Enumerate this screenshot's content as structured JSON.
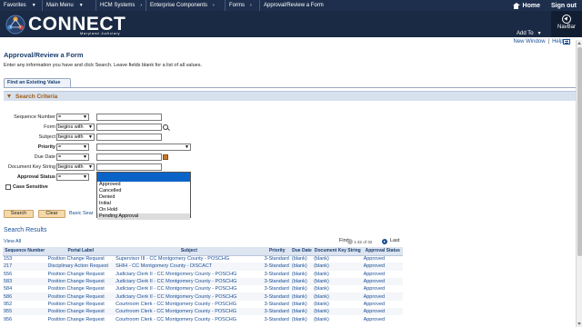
{
  "topnav": {
    "items": [
      {
        "label": "Favorites"
      },
      {
        "label": "Main Menu"
      },
      {
        "label": "HCM Systems"
      },
      {
        "label": "Enterprise Components"
      },
      {
        "label": "Forms"
      },
      {
        "label": "Approval/Review a Form"
      }
    ],
    "home": "Home",
    "signout": "Sign out"
  },
  "banner": {
    "logo_text": "CONNECT",
    "logo_subtitle": "Maryland Judiciary",
    "add_to": "Add To",
    "navbar": "NavBar"
  },
  "utility": {
    "new_window": "New Window",
    "help": "Help"
  },
  "page": {
    "title": "Approval/Review a Form",
    "instructions": "Enter any information you have and click Search. Leave fields blank for a list of all values.",
    "tab_label": "Find an Existing Value",
    "section_title": "Search Criteria"
  },
  "criteria": {
    "sequence_number": {
      "label": "Sequence Number",
      "operator": "="
    },
    "form": {
      "label": "Form",
      "operator": "begins with"
    },
    "subject": {
      "label": "Subject",
      "operator": "begins with"
    },
    "priority": {
      "label": "Priority",
      "operator": "="
    },
    "due_date": {
      "label": "Due Date",
      "operator": "="
    },
    "document_key_string": {
      "label": "Document Key String",
      "operator": "begins with"
    },
    "approval_status": {
      "label": "Approval Status",
      "operator": "=",
      "options": [
        "Approved",
        "Cancelled",
        "Denied",
        "Initial",
        "On Hold",
        "Pending Approval"
      ]
    },
    "case_sensitive": "Case Sensitive"
  },
  "buttons": {
    "search": "Search",
    "clear": "Clear",
    "basic_search": "Basic Sear"
  },
  "results": {
    "title": "Search Results",
    "view_all": "View All",
    "pager": {
      "first": "First",
      "count": "1-32 of 32",
      "last": "Last"
    },
    "columns": [
      "Sequence Number",
      "Portal Label",
      "Subject",
      "Priority",
      "Due Date",
      "Document Key String",
      "Approval Status"
    ],
    "rows": [
      [
        "153",
        "Position Change Request",
        "Supervisor III - CC Montgomery County - POSCHG",
        "3-Standard",
        "(blank)",
        "(blank)",
        "Approved"
      ],
      [
        "217",
        "Disciplinary Action Request",
        "SHIH - CC Montgomery County - DISCACT",
        "3-Standard",
        "(blank)",
        "(blank)",
        "Approved"
      ],
      [
        "556",
        "Position Change Request",
        "Judiciary Clerk II - CC Montgomery County - POSCHG",
        "3-Standard",
        "(blank)",
        "(blank)",
        "Approved"
      ],
      [
        "583",
        "Position Change Request",
        "Judiciary Clerk II - CC Montgomery County - POSCHG",
        "3-Standard",
        "(blank)",
        "(blank)",
        "Approved"
      ],
      [
        "584",
        "Position Change Request",
        "Judiciary Clerk II - CC Montgomery County - POSCHG",
        "3-Standard",
        "(blank)",
        "(blank)",
        "Approved"
      ],
      [
        "586",
        "Position Change Request",
        "Judiciary Clerk II - CC Montgomery County - POSCHG",
        "3-Standard",
        "(blank)",
        "(blank)",
        "Approved"
      ],
      [
        "952",
        "Position Change Request",
        "Courtroom Clerk - CC Montgomery County - POSCHG",
        "3-Standard",
        "(blank)",
        "(blank)",
        "Approved"
      ],
      [
        "955",
        "Position Change Request",
        "Courtroom Clerk - CC Montgomery County - POSCHG",
        "3-Standard",
        "(blank)",
        "(blank)",
        "Approved"
      ],
      [
        "956",
        "Position Change Request",
        "Courtroom Clerk - CC Montgomery County - POSCHG",
        "3-Standard",
        "(blank)",
        "(blank)",
        "Approved"
      ]
    ]
  },
  "colors": {
    "nav": "#1e2f4d",
    "banner": "#1a2a44",
    "link": "#1a4f95",
    "section_text": "#a05a14",
    "button": "#f6d9a8",
    "selected_option": "#0a64c8"
  }
}
